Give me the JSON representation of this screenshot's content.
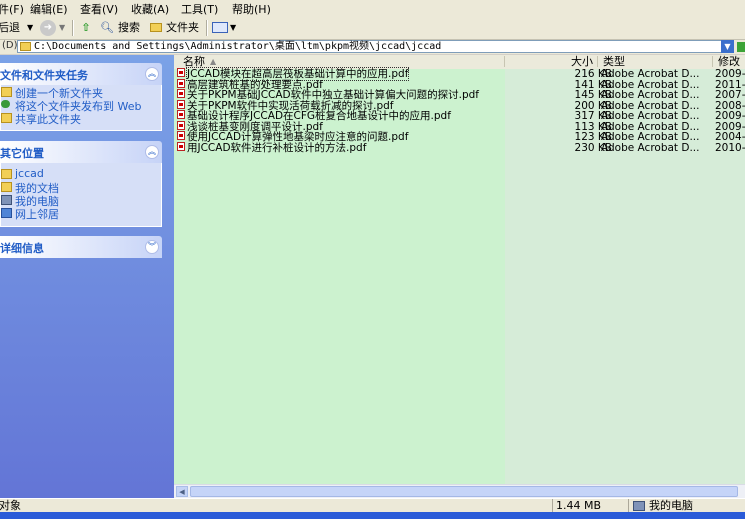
{
  "menu": {
    "file": "件(F)",
    "edit": "编辑(E)",
    "view": "查看(V)",
    "favorites": "收藏(A)",
    "tools": "工具(T)",
    "help": "帮助(H)"
  },
  "toolbar": {
    "back": "后退",
    "search": "搜索",
    "folders": "文件夹"
  },
  "address": {
    "label": "(D)",
    "path": "C:\\Documents and Settings\\Administrator\\桌面\\ltm\\pkpm视频\\jccad\\jccad"
  },
  "left_panel": {
    "tasks": {
      "title": "文件和文件夹任务",
      "items": [
        "创建一个新文件夹",
        "将这个文件夹发布到 Web",
        "共享此文件夹"
      ]
    },
    "other_places": {
      "title": "其它位置",
      "items": [
        "jccad",
        "我的文档",
        "我的电脑",
        "网上邻居"
      ]
    },
    "details": {
      "title": "详细信息"
    }
  },
  "columns": {
    "name": "名称",
    "size": "大小",
    "type": "类型",
    "modified": "修改"
  },
  "files": [
    {
      "name": "JCCAD模块在超高层筏板基础计算中的应用.pdf",
      "size": "216 KB",
      "type": "Adobe Acrobat D...",
      "date": "2009-"
    },
    {
      "name": "高层建筑桩基的处理要点.pdf",
      "size": "141 KB",
      "type": "Adobe Acrobat D...",
      "date": "2011-"
    },
    {
      "name": "关于PKPM基础JCCAD软件中独立基础计算偏大问题的探讨.pdf",
      "size": "145 KB",
      "type": "Adobe Acrobat D...",
      "date": "2007-"
    },
    {
      "name": "关于PKPM软件中实现活荷载折减的探讨.pdf",
      "size": "200 KB",
      "type": "Adobe Acrobat D...",
      "date": "2008-"
    },
    {
      "name": "基础设计程序JCCAD在CFG桩复合地基设计中的应用.pdf",
      "size": "317 KB",
      "type": "Adobe Acrobat D...",
      "date": "2009-"
    },
    {
      "name": "浅谈桩基变刚度调平设计.pdf",
      "size": "113 KB",
      "type": "Adobe Acrobat D...",
      "date": "2009-"
    },
    {
      "name": "使用JCCAD计算弹性地基梁时应注意的问题.pdf",
      "size": "123 KB",
      "type": "Adobe Acrobat D...",
      "date": "2004-"
    },
    {
      "name": "用JCCAD软件进行补桩设计的方法.pdf",
      "size": "230 KB",
      "type": "Adobe Acrobat D...",
      "date": "2010-"
    }
  ],
  "status": {
    "left": "对象",
    "size": "1.44 MB",
    "location": "我的电脑"
  }
}
